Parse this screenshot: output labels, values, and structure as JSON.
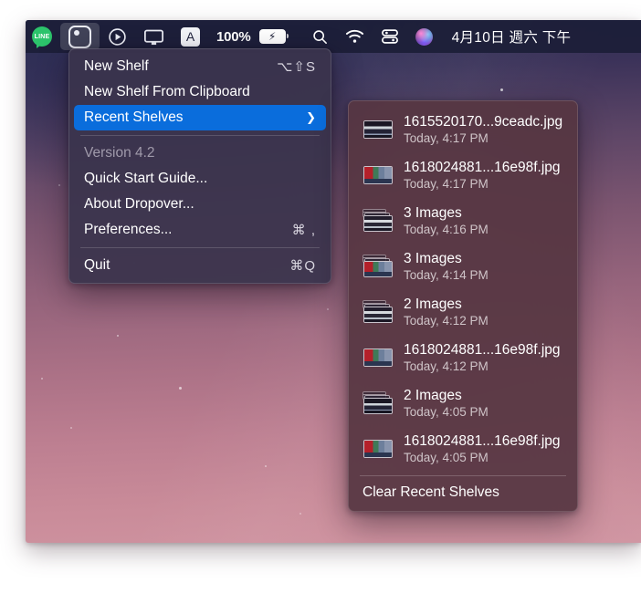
{
  "menubar": {
    "items": [
      {
        "name": "line",
        "icon": "line-messenger-icon",
        "label": "LINE"
      },
      {
        "name": "dropover",
        "icon": "dropover-shelf-icon",
        "label": ""
      },
      {
        "name": "player",
        "icon": "play-circle-icon",
        "label": ""
      },
      {
        "name": "display",
        "icon": "display-monitor-icon",
        "label": ""
      },
      {
        "name": "input-source",
        "icon": "input-source-a-icon",
        "label": "A"
      }
    ],
    "battery_percent": "100%",
    "battery_icon": "battery-charging-icon",
    "search_icon": "search-icon",
    "wifi_icon": "wifi-icon",
    "control_center_icon": "control-center-icon",
    "siri_icon": "siri-icon",
    "clock": "4月10日 週六 下午"
  },
  "main_menu": {
    "items": [
      {
        "label": "New Shelf",
        "shortcut": "⌥⇧S",
        "state": "normal"
      },
      {
        "label": "New Shelf From Clipboard",
        "shortcut": "",
        "state": "normal"
      },
      {
        "label": "Recent Shelves",
        "shortcut": "",
        "state": "highlight",
        "submenu_arrow": "❯"
      },
      {
        "label": "Version 4.2",
        "shortcut": "",
        "state": "disabled"
      },
      {
        "label": "Quick Start Guide...",
        "shortcut": "",
        "state": "normal"
      },
      {
        "label": "About Dropover...",
        "shortcut": "",
        "state": "normal"
      },
      {
        "label": "Preferences...",
        "shortcut": "⌘ ,",
        "state": "normal"
      },
      {
        "label": "Quit",
        "shortcut": "⌘Q",
        "state": "normal"
      }
    ]
  },
  "submenu": {
    "items": [
      {
        "title": "1615520170...9ceadc.jpg",
        "subtitle": "Today, 4:17 PM",
        "thumb": "single-dark"
      },
      {
        "title": "1618024881...16e98f.jpg",
        "subtitle": "Today, 4:17 PM",
        "thumb": "single-red"
      },
      {
        "title": "3 Images",
        "subtitle": "Today, 4:16 PM",
        "thumb": "stack-grey"
      },
      {
        "title": "3 Images",
        "subtitle": "Today, 4:14 PM",
        "thumb": "stack-red"
      },
      {
        "title": "2 Images",
        "subtitle": "Today, 4:12 PM",
        "thumb": "stack-grey"
      },
      {
        "title": "1618024881...16e98f.jpg",
        "subtitle": "Today, 4:12 PM",
        "thumb": "single-red"
      },
      {
        "title": "2 Images",
        "subtitle": "Today, 4:05 PM",
        "thumb": "stack-dark"
      },
      {
        "title": "1618024881...16e98f.jpg",
        "subtitle": "Today, 4:05 PM",
        "thumb": "single-red"
      }
    ],
    "clear_label": "Clear Recent Shelves"
  },
  "colors": {
    "menubar_bg": "#1c1e38",
    "menu_bg": "#3a344c",
    "submenu_bg": "#563642",
    "highlight_blue": "#0a6ddc",
    "wallpaper_top": "#2b2d52",
    "wallpaper_bottom": "#cf93a0"
  }
}
